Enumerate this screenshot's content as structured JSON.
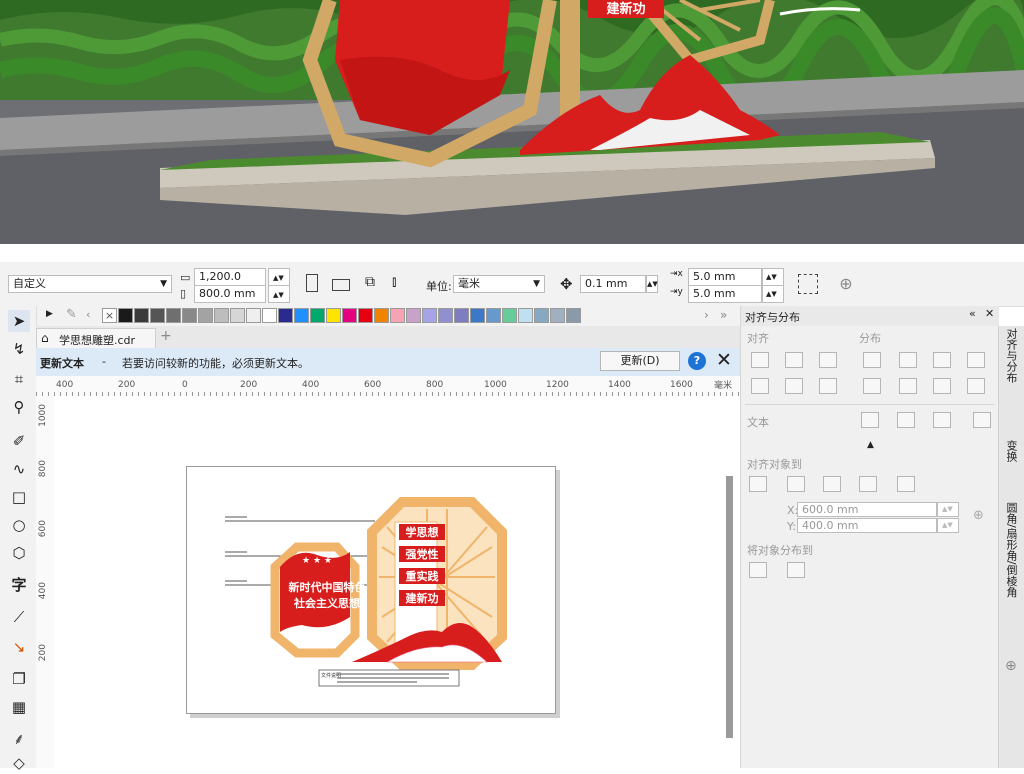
{
  "photo": {
    "sign_text": "建新功"
  },
  "property_bar": {
    "preset": "自定义",
    "width": "1,200.0 mm",
    "height": "800.0 mm",
    "units_label": "单位:",
    "units_value": "毫米",
    "nudge": "0.1 mm",
    "dup_x": "5.0 mm",
    "dup_y": "5.0 mm"
  },
  "palette": {
    "colors": [
      "#ffffff",
      "#1a1a1a",
      "#3a3a3a",
      "#555555",
      "#6f6f6f",
      "#898989",
      "#a3a3a3",
      "#bdbdbd",
      "#d6d6d6",
      "#efefef",
      "#ffffff",
      "#2b2b8f",
      "#1e90ff",
      "#00a86b",
      "#ffe400",
      "#e4007f",
      "#e60012",
      "#f08300",
      "#f5a3b5",
      "#c8a2c8",
      "#a4a4e6",
      "#9090d0",
      "#7d7dc0",
      "#3c78c8",
      "#6699cc",
      "#66cc99",
      "#bfe0f0",
      "#86a8c2",
      "#a0b0c0",
      "#8a9aaa"
    ]
  },
  "document": {
    "tab_label": "学思想雕塑.cdr"
  },
  "update_bar": {
    "title": "更新文本",
    "separator": "-",
    "message": "若要访问较新的功能，必须更新文本。",
    "button": "更新(D)"
  },
  "ruler": {
    "h_ticks": [
      "400",
      "200",
      "0",
      "200",
      "400",
      "600",
      "800",
      "1000",
      "1200",
      "1400",
      "1600"
    ],
    "unit": "毫米",
    "v_ticks": [
      "1000",
      "800",
      "600",
      "400",
      "200"
    ]
  },
  "artwork": {
    "left_panel_line1": "新时代中国特色",
    "left_panel_line2": "社会主义思想",
    "right_items": [
      "学思想",
      "强党性",
      "重实践",
      "建新功"
    ],
    "caption_label": "文件说明"
  },
  "docker": {
    "title": "对齐与分布",
    "align_label": "对齐",
    "distribute_label": "分布",
    "text_label": "文本",
    "align_to_label": "对齐对象到",
    "x_label": "X:",
    "x_value": "600.0 mm",
    "y_label": "Y:",
    "y_value": "400.0 mm",
    "distribute_to_label": "将对象分布到"
  },
  "docker_tabs": [
    "对齐与分布",
    "变换",
    "圆角/扇形角/倒棱角"
  ]
}
